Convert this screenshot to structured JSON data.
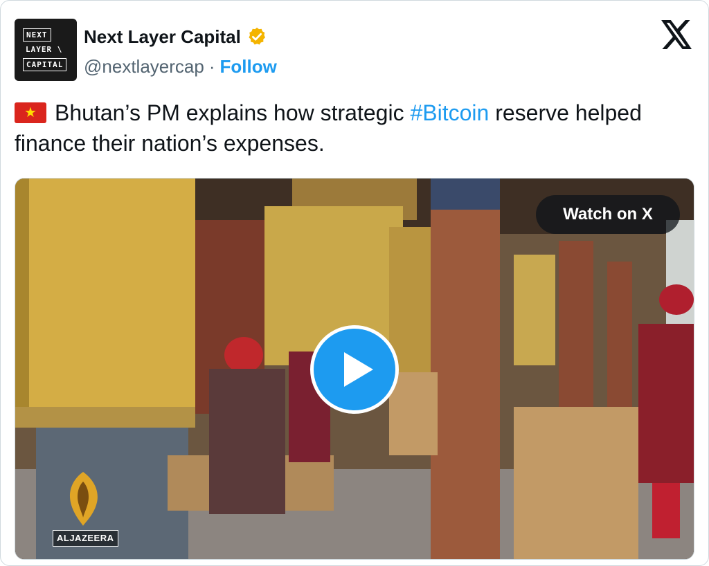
{
  "author": {
    "name": "Next Layer Capital",
    "handle": "@nextlayercap",
    "separator": "·",
    "follow_label": "Follow",
    "avatar_lines": [
      "NEXT",
      "LAYER \\",
      "CAPITAL"
    ],
    "verified_icon": "verified-badge-icon",
    "verified_color": "#f4b400"
  },
  "platform_icon": "x-logo-icon",
  "tweet": {
    "flag_icon": "vietnam-flag-icon",
    "text_before": "Bhutan’s PM explains how strategic ",
    "hashtag": "#Bitcoin",
    "text_after": " reserve helped finance their nation’s expenses."
  },
  "media": {
    "watch_label": "Watch on X",
    "play_icon": "play-icon",
    "watermark_text": "ALJAZEERA",
    "watermark_icon": "aljazeera-logo-icon"
  },
  "colors": {
    "accent": "#1d9bf0",
    "text": "#0f1419",
    "muted": "#536471",
    "border": "#cfd9de"
  }
}
